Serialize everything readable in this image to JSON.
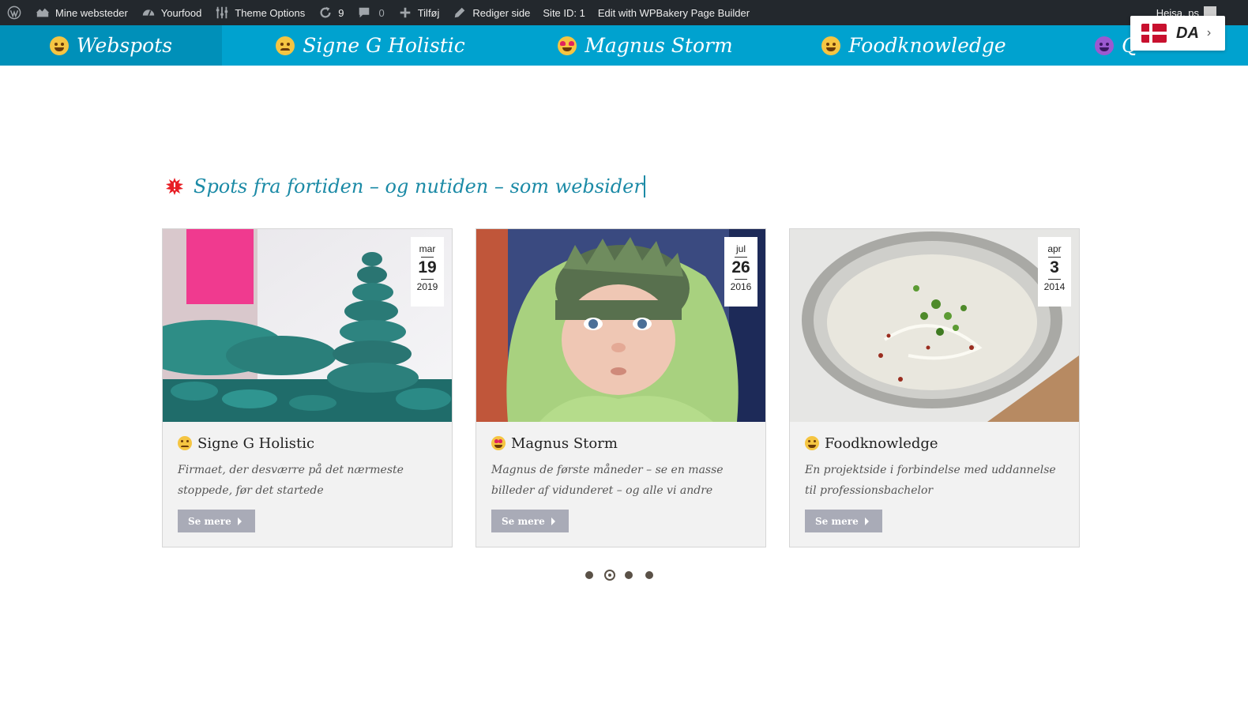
{
  "adminbar": {
    "items": [
      {
        "label": "",
        "icon": "wordpress-icon"
      },
      {
        "label": "Mine websteder",
        "icon": "sites-icon"
      },
      {
        "label": "Yourfood",
        "icon": "dashboard-icon"
      },
      {
        "label": "Theme Options",
        "icon": "sliders-icon"
      },
      {
        "label": "9",
        "icon": "updates-icon"
      },
      {
        "label": "0",
        "icon": "comments-icon"
      },
      {
        "label": "Tilføj",
        "icon": "plus-icon"
      },
      {
        "label": "Rediger side",
        "icon": "pencil-icon"
      },
      {
        "label": "Site ID: 1"
      },
      {
        "label": "Edit with WPBakery Page Builder"
      }
    ],
    "greeting": "Hejsa, ps"
  },
  "nav": {
    "items": [
      {
        "label": "Webspots",
        "emoji": "grinning-emoji",
        "active": true
      },
      {
        "label": "Signe G Holistic",
        "emoji": "disappointed-emoji",
        "active": false
      },
      {
        "label": "Magnus Storm",
        "emoji": "heart-eyes-emoji",
        "active": false
      },
      {
        "label": "Foodknowledge",
        "emoji": "yum-emoji",
        "active": false
      },
      {
        "label": "Q",
        "emoji": "devil-emoji",
        "active": false
      }
    ]
  },
  "language": {
    "code": "DA",
    "flag": "denmark-flag-icon"
  },
  "section": {
    "title": "Spots fra fortiden – og nutiden – som websider",
    "icon": "burst-icon"
  },
  "cards": [
    {
      "month": "mar",
      "day": "19",
      "year": "2019",
      "title": "Signe G Holistic",
      "emoji": "disappointed-emoji",
      "description": "Firmaet, der desværre på det nærmeste stoppede, før det startede",
      "button": "Se mere"
    },
    {
      "month": "jul",
      "day": "26",
      "year": "2016",
      "title": "Magnus Storm",
      "emoji": "heart-eyes-emoji",
      "description": "Magnus de første måneder – se en masse billeder af vidunderet – og alle vi andre",
      "button": "Se mere"
    },
    {
      "month": "apr",
      "day": "3",
      "year": "2014",
      "title": "Foodknowledge",
      "emoji": "yum-emoji",
      "description": "En projektside i forbindelse med uddannelse til professionsbachelor",
      "button": "Se mere"
    }
  ],
  "carousel": {
    "pages": 4,
    "active_index": 1
  },
  "colors": {
    "adminbar": "#23282d",
    "nav": "#00a2cf",
    "nav_active": "#0090b9",
    "title": "#1b8aa6",
    "button": "#a9abb7",
    "burst": "#e81e25"
  }
}
